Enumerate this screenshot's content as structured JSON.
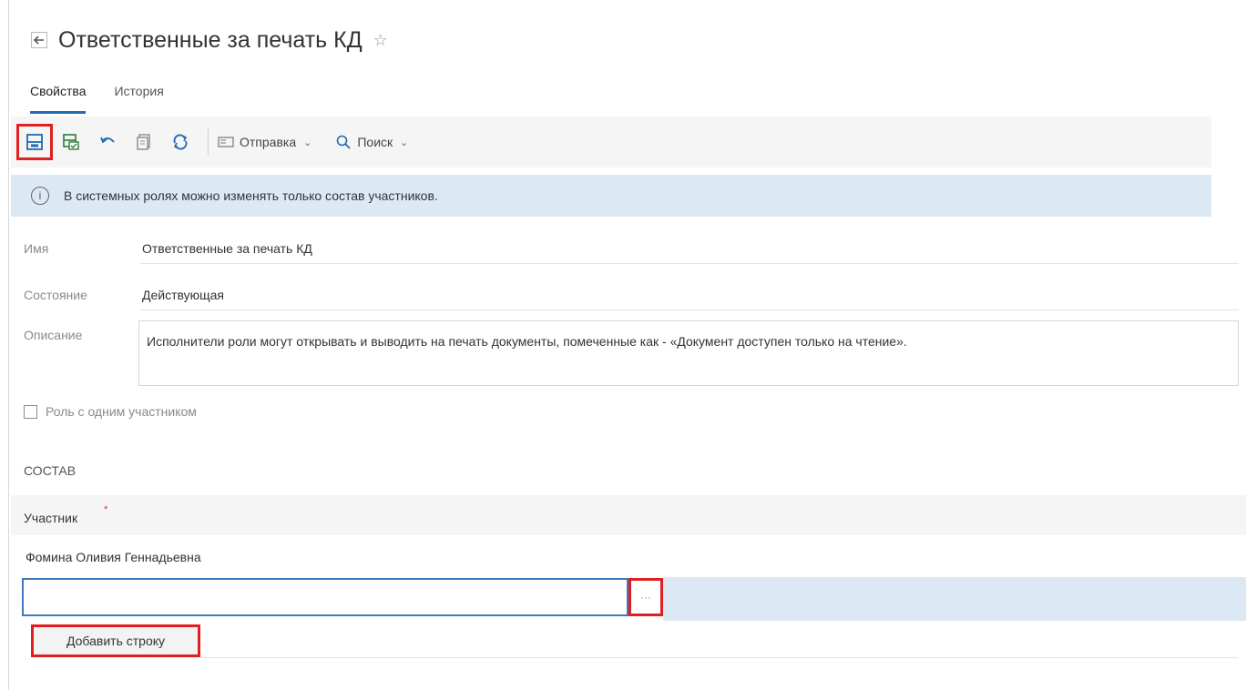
{
  "header": {
    "title": "Ответственные за печать КД",
    "back_icon": "arrow-left-icon",
    "favorite_icon": "star-outline-icon"
  },
  "tabs": [
    {
      "label": "Свойства",
      "active": true
    },
    {
      "label": "История",
      "active": false
    }
  ],
  "toolbar": {
    "buttons": [
      "save-icon",
      "save-and-close-icon",
      "undo-icon",
      "copy-icon",
      "refresh-icon"
    ],
    "send_label": "Отправка",
    "search_label": "Поиск"
  },
  "info": {
    "text": "В системных ролях можно изменять только состав участников."
  },
  "fields": {
    "name_label": "Имя",
    "name_value": "Ответственные за печать КД",
    "state_label": "Состояние",
    "state_value": "Действующая",
    "description_label": "Описание",
    "description_value": "Исполнители роли могут открывать и выводить на печать документы, помеченные как - «Документ доступен только на чтение».",
    "single_participant_label": "Роль с одним участником",
    "single_participant_checked": false
  },
  "composition": {
    "section_title": "СОСТАВ",
    "column_header": "Участник",
    "rows": [
      "Фомина Оливия Геннадьевна"
    ],
    "new_row_value": "",
    "ellipsis_label": "···",
    "add_row_label": "Добавить строку"
  },
  "colors": {
    "accent": "#1f6bb5",
    "highlight": "#e02020",
    "info_bg": "#dde8f5"
  }
}
